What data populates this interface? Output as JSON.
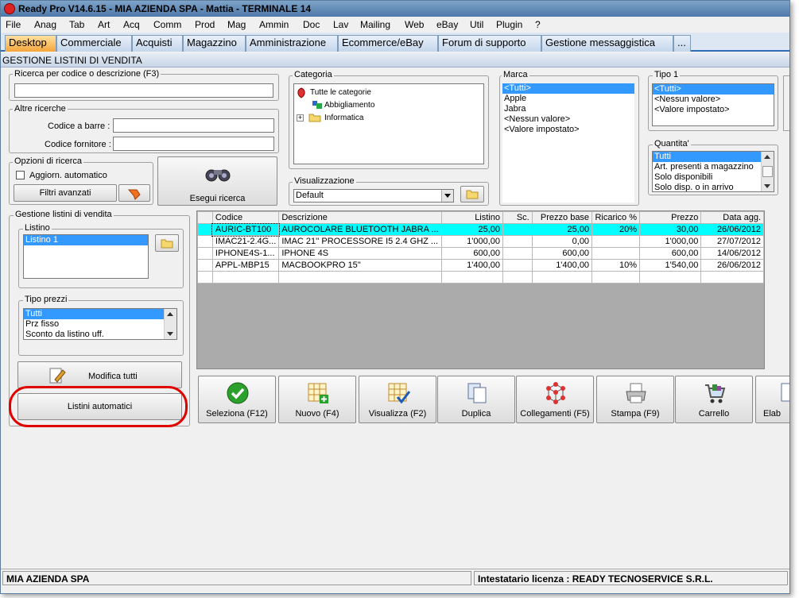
{
  "window": {
    "title": "Ready Pro V14.6.15 - MIA AZIENDA SPA - Mattia - TERMINALE 14"
  },
  "menu": [
    "File",
    "Anag",
    "Tab",
    "Art",
    "Acq",
    "Comm",
    "Prod",
    "Mag",
    "Ammin",
    "Doc",
    "Lav",
    "Mailing",
    "Web",
    "eBay",
    "Util",
    "Plugin",
    "?"
  ],
  "tabs": [
    "Desktop",
    "Commerciale",
    "Acquisti",
    "Magazzino",
    "Amministrazione",
    "Ecommerce/eBay",
    "Forum di supporto",
    "Gestione messaggistica",
    "..."
  ],
  "section_title": "GESTIONE LISTINI DI VENDITA",
  "search": {
    "label": "Ricerca per codice o descrizione (F3)",
    "value": ""
  },
  "altre": {
    "label": "Altre ricerche",
    "barcode_label": "Codice a barre :",
    "supplier_label": "Codice fornitore :"
  },
  "opzioni": {
    "label": "Opzioni di ricerca",
    "auto_label": "Aggiorn. automatico",
    "auto_checked": false,
    "filters_button": "Filtri avanzati"
  },
  "esegui_button": "Esegui ricerca",
  "categoria": {
    "label": "Categoria",
    "items": [
      "Tutte le categorie",
      "Abbigliamento",
      "Informatica"
    ]
  },
  "visualizzazione": {
    "label": "Visualizzazione",
    "value": "Default"
  },
  "marca": {
    "label": "Marca",
    "items": [
      "<Tutti>",
      "Apple",
      "Jabra",
      "<Nessun valore>",
      "<Valore impostato>"
    ]
  },
  "tipo1": {
    "label": "Tipo 1",
    "items": [
      "<Tutti>",
      "<Nessun valore>",
      "<Valore impostato>"
    ]
  },
  "quantita": {
    "label": "Quantita'",
    "items": [
      "Tutti",
      "Art. presenti a magazzino",
      "Solo disponibili",
      "Solo disp. o in arrivo"
    ]
  },
  "gestione": {
    "label": "Gestione listini di vendita",
    "listino_label": "Listino",
    "listino_items": [
      "Listino 1"
    ],
    "tipo_prezzi_label": "Tipo prezzi",
    "tipo_prezzi_items": [
      "Tutti",
      "Prz fisso",
      "Sconto da listino uff."
    ],
    "modifica_button": "Modifica tutti",
    "automatici_button": "Listini automatici"
  },
  "grid": {
    "columns": [
      "Codice",
      "Descrizione",
      "Listino",
      "Sc.",
      "Prezzo base",
      "Ricarico %",
      "Prezzo",
      "Data agg."
    ],
    "rows": [
      [
        "AURIC-BT100",
        "AUROCOLARE BLUETOOTH JABRA ...",
        "25,00",
        "",
        "25,00",
        "20%",
        "30,00",
        "26/06/2012"
      ],
      [
        "IMAC21-2.4G...",
        "IMAC 21'' PROCESSORE I5 2.4 GHZ ...",
        "1'000,00",
        "",
        "0,00",
        "",
        "1'000,00",
        "27/07/2012"
      ],
      [
        "IPHONE4S-1...",
        "IPHONE 4S",
        "600,00",
        "",
        "600,00",
        "",
        "600,00",
        "14/06/2012"
      ],
      [
        "APPL-MBP15",
        "MACBOOKPRO 15''",
        "1'400,00",
        "",
        "1'400,00",
        "10%",
        "1'540,00",
        "26/06/2012"
      ]
    ]
  },
  "toolbar": [
    "Seleziona (F12)",
    "Nuovo (F4)",
    "Visualizza (F2)",
    "Duplica",
    "Collegamenti (F5)",
    "Stampa (F9)",
    "Carrello",
    "Elab"
  ],
  "status": {
    "company": "MIA AZIENDA SPA",
    "license": "Intestatario licenza : READY TECNOSERVICE S.R.L."
  }
}
